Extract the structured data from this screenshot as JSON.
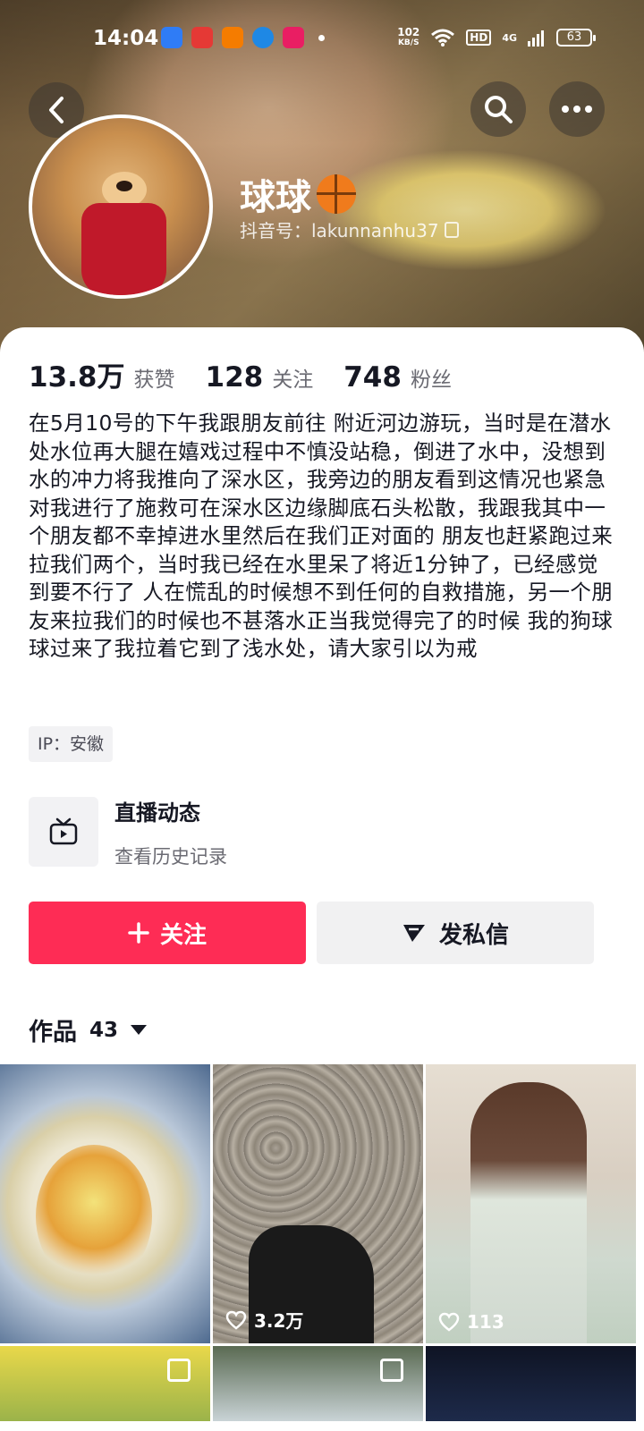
{
  "status_bar": {
    "time": "14:04",
    "net_speed": "102",
    "net_unit": "KB/S",
    "hd": "HD",
    "signal": "4G",
    "battery": "63",
    "app_colors": [
      "#2f7cf6",
      "#e53935",
      "#f57c00",
      "#1e88e5",
      "#e91e63"
    ]
  },
  "header": {
    "back_icon": "chevron-left-icon",
    "search_icon": "search-icon",
    "more_icon": "more-dots-icon"
  },
  "profile": {
    "nickname": "球球",
    "emoji_icon": "basketball-icon",
    "douyin_id": "抖音号：lakunnanhu37",
    "stats": [
      {
        "value": "13.8万",
        "label": "获赞"
      },
      {
        "value": "128",
        "label": "关注"
      },
      {
        "value": "748",
        "label": "粉丝"
      }
    ],
    "bio": "在5月10号的下午我跟朋友前往 附近河边游玩，当时是在潜水处水位再大腿在嬉戏过程中不慎没站稳，倒进了水中，没想到水的冲力将我推向了深水区，我旁边的朋友看到这情况也紧急对我进行了施救可在深水区边缘脚底石头松散，我跟我其中一个朋友都不幸掉进水里然后在我们正对面的 朋友也赶紧跑过来拉我们两个，当时我已经在水里呆了将近1分钟了，已经感觉到要不行了 人在慌乱的时候想不到任何的自救措施，另一个朋友来拉我们的时候也不甚落水正当我觉得完了的时候 我的狗球球过来了我拉着它到了浅水处，请大家引以为戒",
    "ip": "IP：安徽"
  },
  "live_section": {
    "title": "直播动态",
    "subtitle": "查看历史记录"
  },
  "actions": {
    "follow_label": "关注",
    "message_label": "发私信",
    "follow_color": "#fe2c55"
  },
  "works": {
    "label": "作品",
    "count": "43",
    "items": [
      {
        "likes": ""
      },
      {
        "likes": "3.2万"
      },
      {
        "likes": "113"
      },
      {
        "likes": ""
      },
      {
        "likes": ""
      },
      {
        "likes": ""
      }
    ]
  }
}
